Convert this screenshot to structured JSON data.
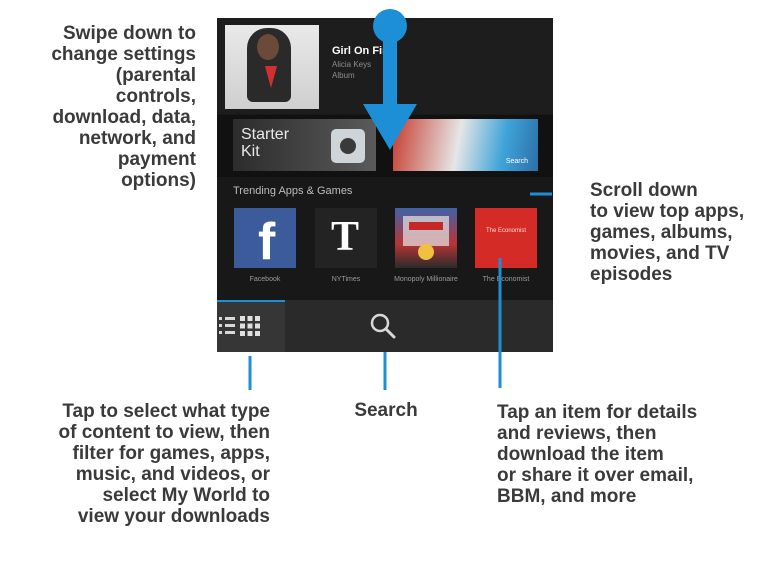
{
  "annotations": {
    "swipe": [
      "Swipe down to",
      "change settings",
      "(parental",
      "controls,",
      "download, data,",
      "network, and",
      "payment",
      "options)"
    ],
    "scroll": [
      "Scroll down",
      "to view top apps,",
      "games, albums,",
      "movies, and TV",
      "episodes"
    ],
    "tap_select": [
      "Tap to select what type",
      "of content to view, then",
      "filter for games, apps,",
      "music, and videos, or",
      "select My World to",
      "view your downloads"
    ],
    "search": [
      "Search"
    ],
    "tap_item": [
      "Tap an item for details",
      "and reviews, then",
      "download the item",
      "or share it over email,",
      "BBM, and more"
    ]
  },
  "screen": {
    "album": {
      "title": "Girl On Fire",
      "sub1": "Alicia Keys",
      "sub2": "Album"
    },
    "featured": {
      "starter_label_1": "Starter",
      "starter_label_2": "Kit",
      "banner_label": "Search"
    },
    "section_header": "Trending Apps & Games",
    "apps": [
      {
        "label": "Facebook"
      },
      {
        "label": "NYTimes"
      },
      {
        "label": "Monopoly Millionaire"
      },
      {
        "label": "The Economist"
      }
    ],
    "economist_icon_text": "The Economist",
    "bottom_bar": {
      "tabs": [
        "list-icon",
        "grid-icon",
        "search-icon"
      ]
    }
  },
  "colors": {
    "accent": "#1d8fd6",
    "facebook": "#3b5b9b",
    "economist": "#d42b26",
    "screen_bg": "#181818"
  }
}
